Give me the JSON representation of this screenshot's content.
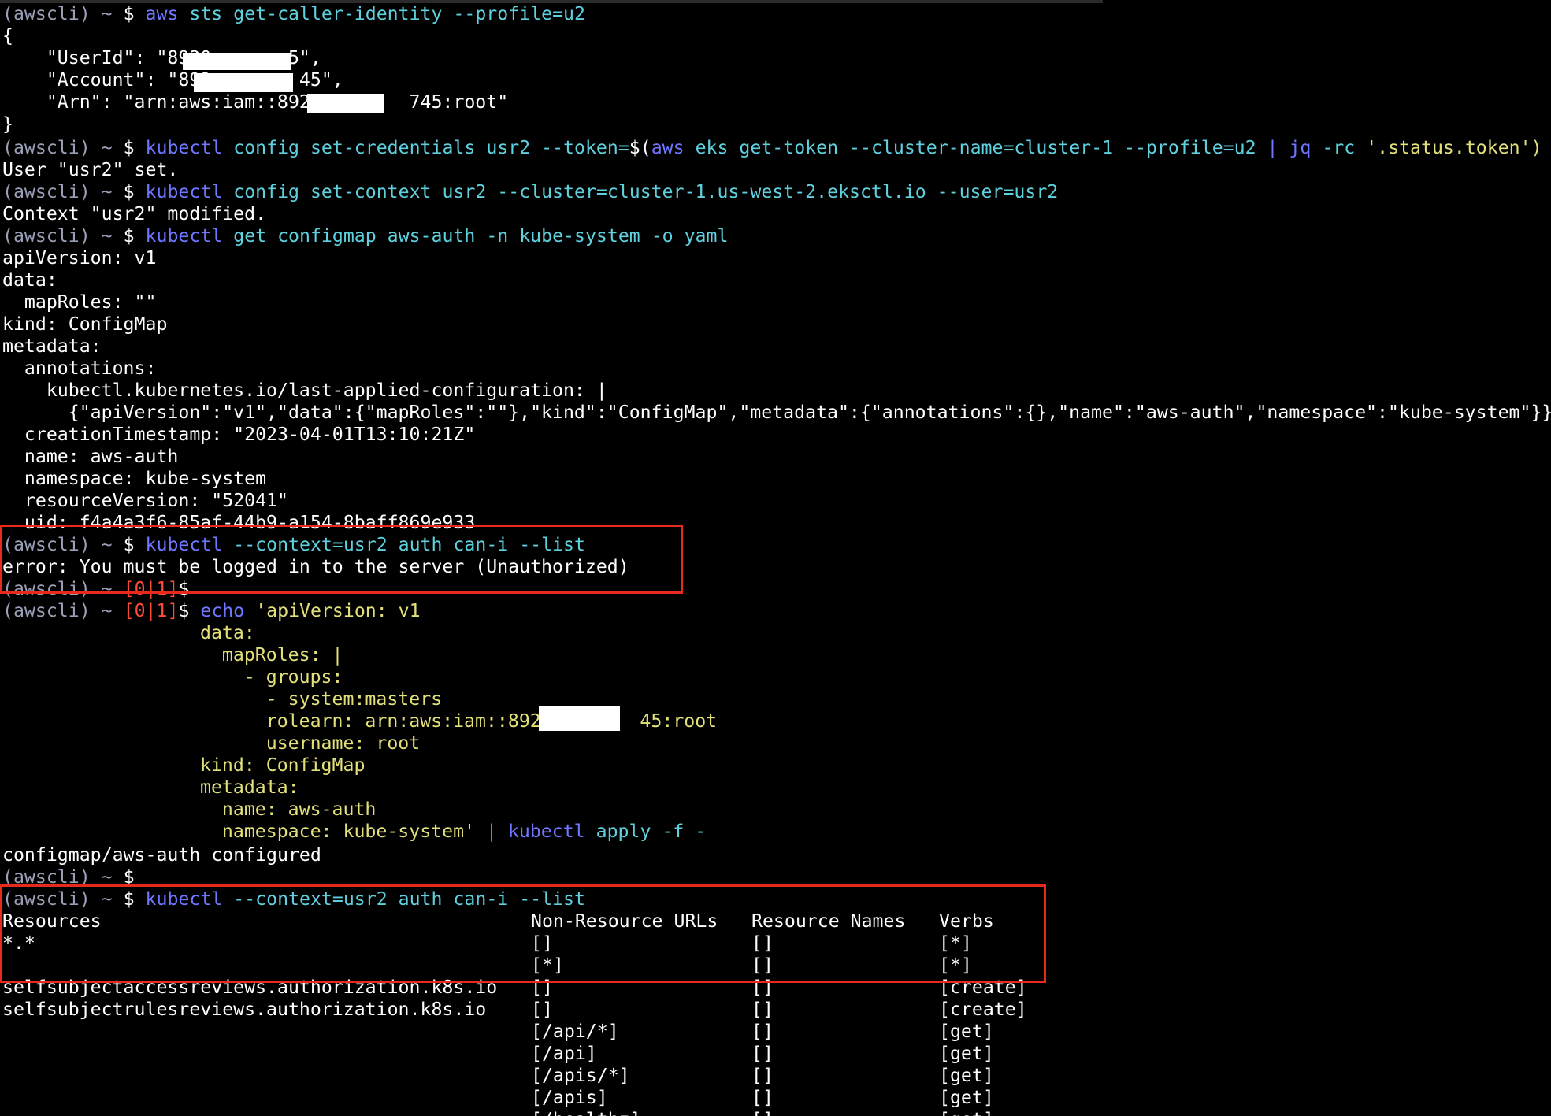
{
  "prompt": {
    "env": "(awscli)",
    "tilde": "~",
    "dollar": "$",
    "exit_open": "[",
    "exit_zero": "0",
    "exit_sep": "|",
    "exit_one": "1",
    "exit_close": "]"
  },
  "cmd1": {
    "tool": "aws",
    "args": "sts get-caller-identity --profile=u2",
    "out": [
      "{",
      "    \"UserId\": \"8920       5\",",
      "    \"Account\": \"892        45\",",
      "    \"Arn\": \"arn:aws:iam::892         745:root\"",
      "}"
    ]
  },
  "cmd2": {
    "tool": "kubectl",
    "args": "config set-credentials usr2 --token=",
    "subst_open": "$(",
    "inner_tool": "aws",
    "inner_args": "eks get-token --cluster-name=cluster-1 --profile=u2",
    "pipe": "|",
    "jq_tool": "jq",
    "jq_args": "-rc",
    "jq_filter": "'.status.token')",
    "out": "User \"usr2\" set."
  },
  "cmd3": {
    "tool": "kubectl",
    "args": "config set-context usr2 --cluster=cluster-1.us-west-2.eksctl.io --user=usr2",
    "out": "Context \"usr2\" modified."
  },
  "cmd4": {
    "tool": "kubectl",
    "args": "get configmap aws-auth -n kube-system -o yaml",
    "out": [
      "apiVersion: v1",
      "data:",
      "  mapRoles: \"\"",
      "kind: ConfigMap",
      "metadata:",
      "  annotations:",
      "    kubectl.kubernetes.io/last-applied-configuration: |",
      "      {\"apiVersion\":\"v1\",\"data\":{\"mapRoles\":\"\"},\"kind\":\"ConfigMap\",\"metadata\":{\"annotations\":{},\"name\":\"aws-auth\",\"namespace\":\"kube-system\"}}",
      "  creationTimestamp: \"2023-04-01T13:10:21Z\"",
      "  name: aws-auth",
      "  namespace: kube-system",
      "  resourceVersion: \"52041\"",
      "  uid: f4a4a3f6-85af-44b9-a154-8baff869e933"
    ]
  },
  "cmd5": {
    "tool": "kubectl",
    "args": "--context=usr2 auth can-i --list",
    "out": "error: You must be logged in to the server (Unauthorized)"
  },
  "cmd6": {
    "tool": "echo",
    "heredoc": [
      "'apiVersion: v1",
      "data:",
      "  mapRoles: |",
      "    - groups:",
      "      - system:masters",
      "      rolearn: arn:aws:iam::892         45:root",
      "      username: root",
      "kind: ConfigMap",
      "metadata:",
      "  name: aws-auth",
      "  namespace: kube-system'"
    ],
    "pipe": "|",
    "apply_tool": "kubectl",
    "apply_args": "apply -f -",
    "out": "configmap/aws-auth configured"
  },
  "cmd7": {
    "tool": "kubectl",
    "args": "--context=usr2 auth can-i --list"
  },
  "can_i_table": {
    "headers": [
      "Resources",
      "Non-Resource URLs",
      "Resource Names",
      "Verbs"
    ],
    "rows": [
      [
        "*.*",
        "[]",
        "[]",
        "[*]"
      ],
      [
        "",
        "[*]",
        "[]",
        "[*]"
      ],
      [
        "selfsubjectaccessreviews.authorization.k8s.io",
        "[]",
        "[]",
        "[create]"
      ],
      [
        "selfsubjectrulesreviews.authorization.k8s.io",
        "[]",
        "[]",
        "[create]"
      ],
      [
        "",
        "[/api/*]",
        "[]",
        "[get]"
      ],
      [
        "",
        "[/api]",
        "[]",
        "[get]"
      ],
      [
        "",
        "[/apis/*]",
        "[]",
        "[get]"
      ],
      [
        "",
        "[/apis]",
        "[]",
        "[get]"
      ],
      [
        "",
        "[/healthz]",
        "[]",
        "[get]"
      ]
    ]
  },
  "colors": {
    "background": "#000000",
    "prompt_gray": "#9a9fb5",
    "command_blue": "#6f77ff",
    "args_cyan": "#5fd0de",
    "heredoc_yellow": "#e3e07a",
    "exit_red": "#ff4b3a",
    "highlight_box": "#e8291c"
  }
}
